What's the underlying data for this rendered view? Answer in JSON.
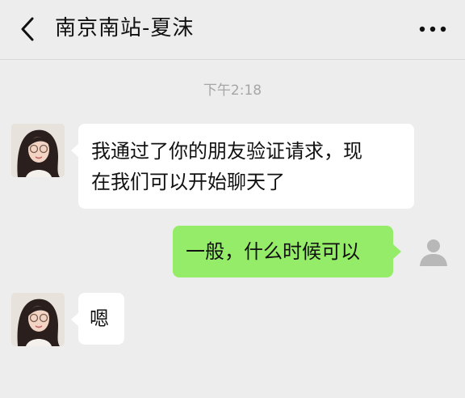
{
  "header": {
    "title": "南京南站-夏沫",
    "back_icon": "chevron-left-icon",
    "more_icon": "more-dots-icon"
  },
  "chat": {
    "timestamp": "下午2:18",
    "messages": [
      {
        "sender": "contact",
        "lines": [
          "我通过了你的朋友验证请求，现",
          "在我们可以开始聊天了"
        ]
      },
      {
        "sender": "me",
        "lines": [
          "一般，什么时候可以"
        ]
      },
      {
        "sender": "contact",
        "lines": [
          "嗯"
        ]
      }
    ]
  },
  "colors": {
    "background": "#ededed",
    "incoming_bubble": "#ffffff",
    "outgoing_bubble": "#95ec69",
    "timestamp": "#a6a6a6"
  }
}
